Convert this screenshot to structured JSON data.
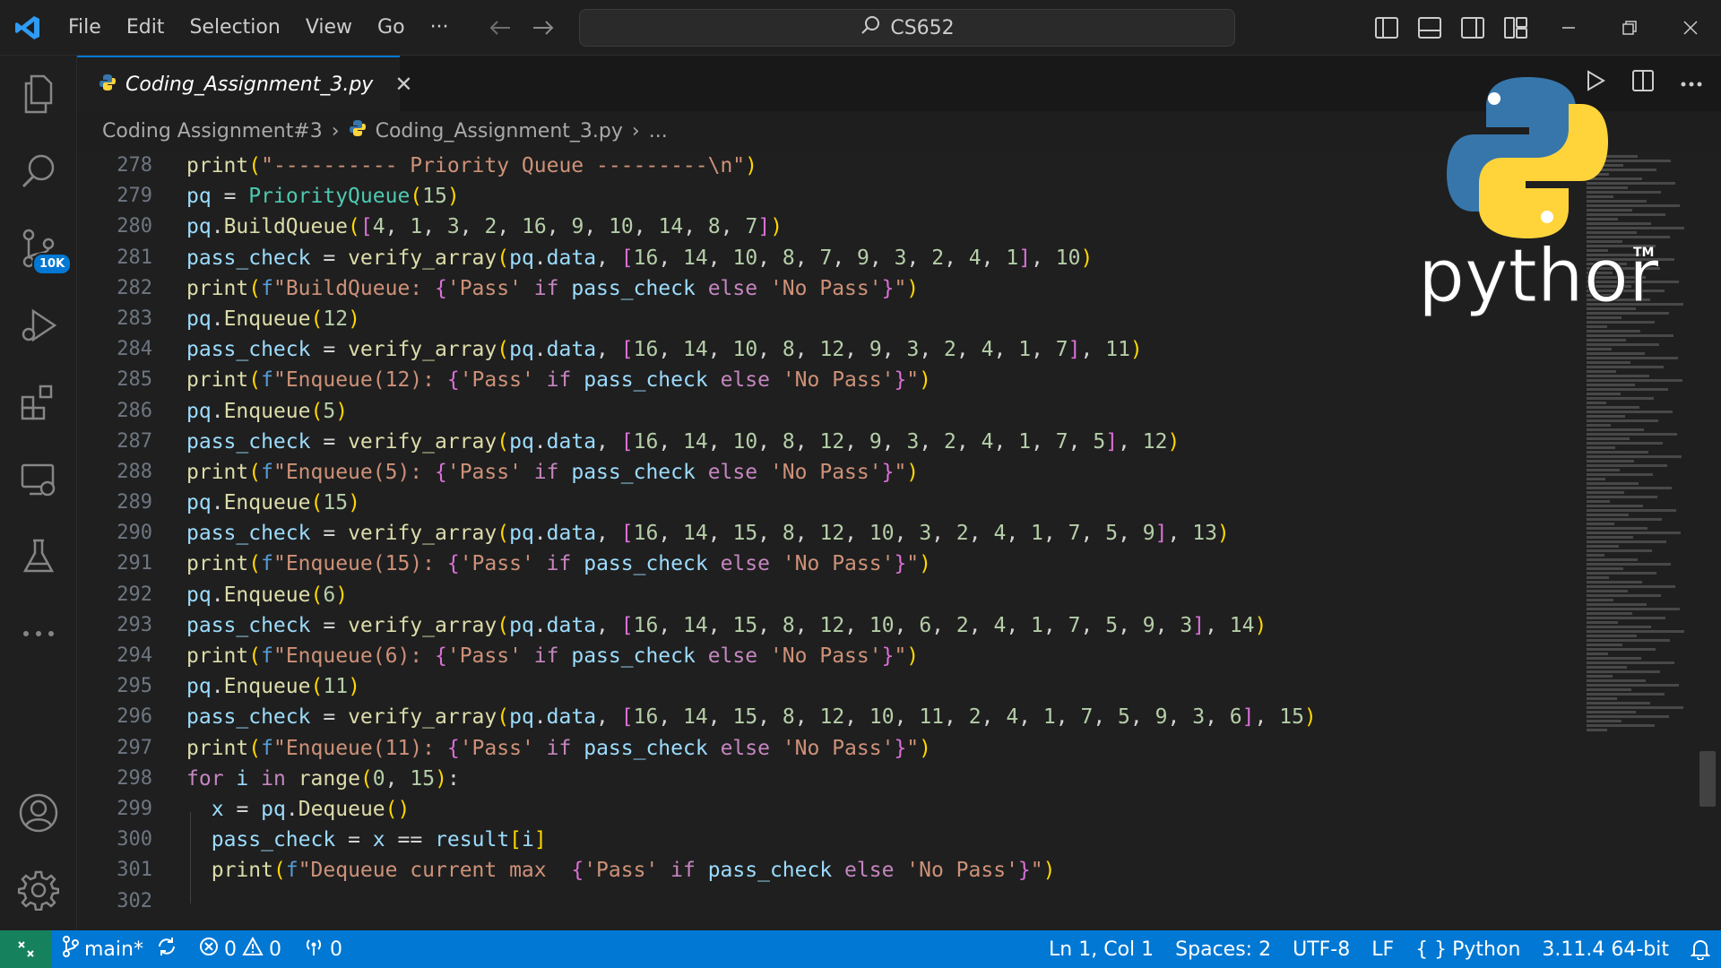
{
  "titlebar": {
    "menu": [
      "File",
      "Edit",
      "Selection",
      "View",
      "Go"
    ],
    "more": "···",
    "search_text": "CS652"
  },
  "activity": {
    "source_control_badge": "10K"
  },
  "tab": {
    "title": "Coding_Assignment_3.py",
    "close": "✕"
  },
  "breadcrumb": {
    "folder": "Coding Assignment#3",
    "file": "Coding_Assignment_3.py",
    "more": "..."
  },
  "editor": {
    "line_numbers": [
      "278",
      "279",
      "280",
      "281",
      "282",
      "283",
      "284",
      "285",
      "286",
      "287",
      "288",
      "289",
      "290",
      "291",
      "292",
      "293",
      "294",
      "295",
      "296",
      "297",
      "298",
      "299",
      "300",
      "301",
      "302"
    ],
    "lines": [
      "print(\"---------- Priority Queue ---------\\n\")",
      "pq = PriorityQueue(15)",
      "pq.BuildQueue([4, 1, 3, 2, 16, 9, 10, 14, 8, 7])",
      "pass_check = verify_array(pq.data, [16, 14, 10, 8, 7, 9, 3, 2, 4, 1], 10)",
      "print(f\"BuildQueue: {'Pass' if pass_check else 'No Pass'}\")",
      "pq.Enqueue(12)",
      "pass_check = verify_array(pq.data, [16, 14, 10, 8, 12, 9, 3, 2, 4, 1, 7], 11)",
      "print(f\"Enqueue(12): {'Pass' if pass_check else 'No Pass'}\")",
      "pq.Enqueue(5)",
      "pass_check = verify_array(pq.data, [16, 14, 10, 8, 12, 9, 3, 2, 4, 1, 7, 5], 12)",
      "print(f\"Enqueue(5): {'Pass' if pass_check else 'No Pass'}\")",
      "pq.Enqueue(15)",
      "pass_check = verify_array(pq.data, [16, 14, 15, 8, 12, 10, 3, 2, 4, 1, 7, 5, 9], 13)",
      "print(f\"Enqueue(15): {'Pass' if pass_check else 'No Pass'}\")",
      "pq.Enqueue(6)",
      "pass_check = verify_array(pq.data, [16, 14, 15, 8, 12, 10, 6, 2, 4, 1, 7, 5, 9, 3], 14)",
      "print(f\"Enqueue(6): {'Pass' if pass_check else 'No Pass'}\")",
      "pq.Enqueue(11)",
      "pass_check = verify_array(pq.data, [16, 14, 15, 8, 12, 10, 11, 2, 4, 1, 7, 5, 9, 3, 6], 15)",
      "print(f\"Enqueue(11): {'Pass' if pass_check else 'No Pass'}\")",
      "for i in range(0, 15):",
      "  x = pq.Dequeue()",
      "  pass_check = x == result[i]",
      "  print(f\"Dequeue current max  {'Pass' if pass_check else 'No Pass'}\")",
      ""
    ]
  },
  "overlay": {
    "python_wordmark": "python",
    "tm": "TM"
  },
  "statusbar": {
    "branch": "main*",
    "errors": "0",
    "warnings": "0",
    "ports": "0",
    "position": "Ln 1, Col 1",
    "spaces": "Spaces: 2",
    "encoding": "UTF-8",
    "eol": "LF",
    "language": "Python",
    "interpreter": "3.11.4 64-bit"
  },
  "colors": {
    "accent": "#0078d4",
    "remote": "#16825d",
    "python_blue": "#3776ab",
    "python_yellow": "#ffd43b"
  }
}
